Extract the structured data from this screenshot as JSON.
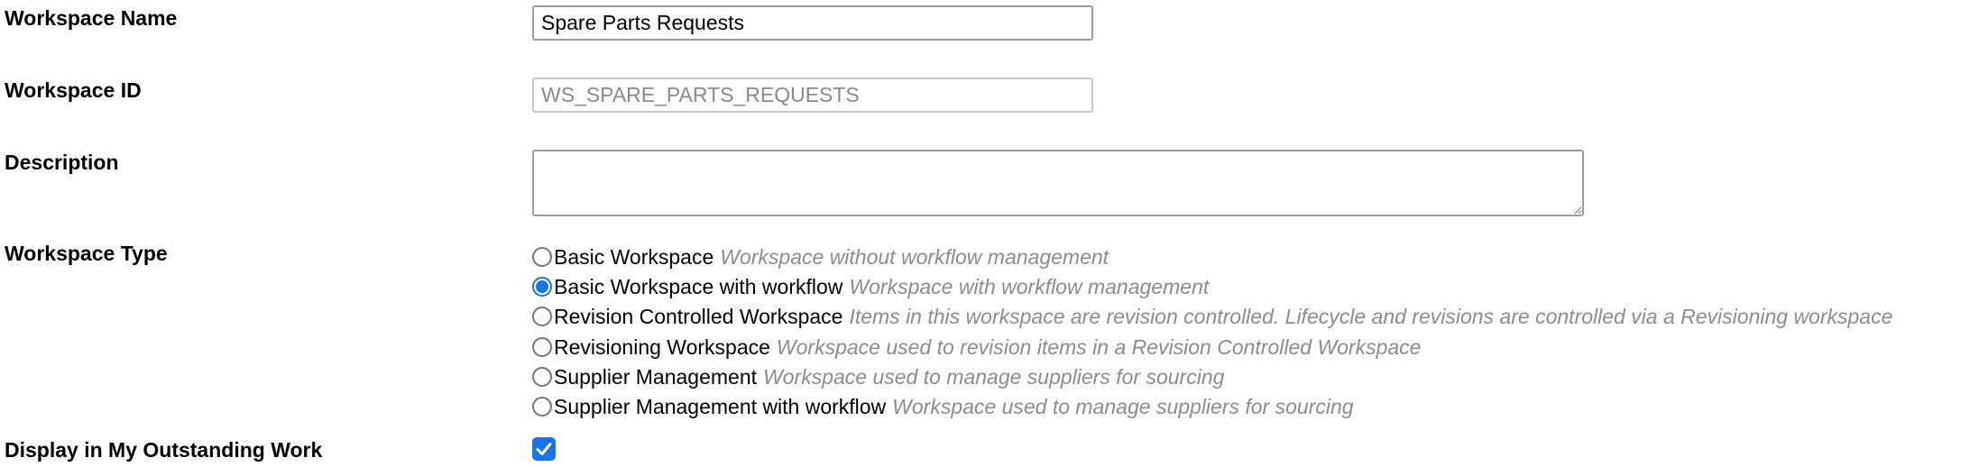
{
  "form": {
    "workspace_name": {
      "label": "Workspace Name",
      "value": "Spare Parts Requests"
    },
    "workspace_id": {
      "label": "Workspace ID",
      "value": "WS_SPARE_PARTS_REQUESTS"
    },
    "description": {
      "label": "Description",
      "value": ""
    },
    "workspace_type": {
      "label": "Workspace Type",
      "selected": "Basic Workspace with workflow",
      "options": [
        {
          "label": "Basic Workspace",
          "description": "Workspace without workflow management"
        },
        {
          "label": "Basic Workspace with workflow",
          "description": "Workspace with workflow management"
        },
        {
          "label": "Revision Controlled Workspace",
          "description": "Items in this workspace are revision controlled. Lifecycle and revisions are controlled via a Revisioning workspace"
        },
        {
          "label": "Revisioning Workspace",
          "description": "Workspace used to revision items in a Revision Controlled Workspace"
        },
        {
          "label": "Supplier Management",
          "description": "Workspace used to manage suppliers for sourcing"
        },
        {
          "label": "Supplier Management with workflow",
          "description": "Workspace used to manage suppliers for sourcing"
        }
      ]
    },
    "outstanding_work": {
      "label": "Display in My Outstanding Work",
      "checked": true
    }
  },
  "colors": {
    "accent": "#1a73e8",
    "description_text": "#8c8c8c"
  }
}
